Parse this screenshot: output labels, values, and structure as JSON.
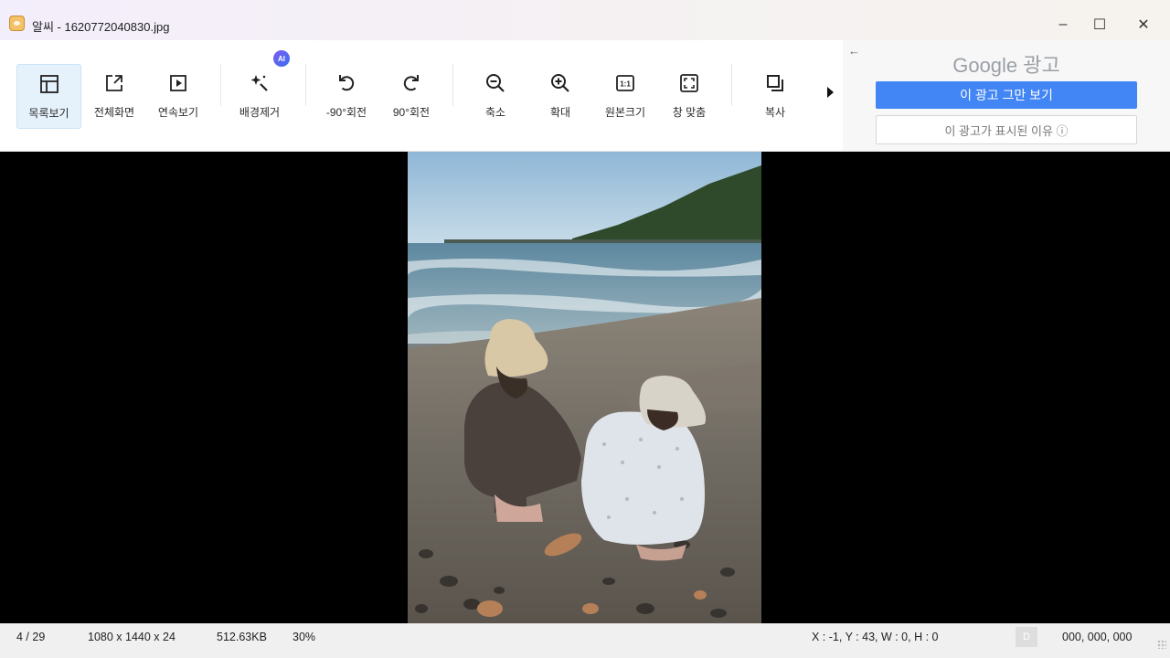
{
  "window": {
    "title": "알씨 - 1620772040830.jpg",
    "controls": {
      "minimize": "–",
      "maximize": "☐",
      "close": "✕"
    }
  },
  "toolbar": {
    "tools": [
      {
        "id": "list-view",
        "label": "목록보기",
        "icon": "layout-icon"
      },
      {
        "id": "fullscreen",
        "label": "전체화면",
        "icon": "external-window-icon"
      },
      {
        "id": "slideshow",
        "label": "연속보기",
        "icon": "play-icon"
      },
      {
        "id": "remove-bg",
        "label": "배경제거",
        "icon": "magic-wand-icon"
      },
      {
        "id": "rotate-left",
        "label": "-90°회전",
        "icon": "rotate-ccw-icon"
      },
      {
        "id": "rotate-right",
        "label": "90°회전",
        "icon": "rotate-cw-icon"
      },
      {
        "id": "zoom-out",
        "label": "축소",
        "icon": "zoom-out-icon"
      },
      {
        "id": "zoom-in",
        "label": "확대",
        "icon": "zoom-in-icon"
      },
      {
        "id": "original-size",
        "label": "원본크기",
        "icon": "one-to-one-icon"
      },
      {
        "id": "fit-window",
        "label": "창 맞춤",
        "icon": "fit-frame-icon"
      },
      {
        "id": "copy",
        "label": "복사",
        "icon": "copy-icon"
      }
    ],
    "ai_badge": "AI"
  },
  "ad": {
    "back": "←",
    "brand": "Google 광고",
    "stop_button": "이 광고 그만 보기",
    "why_button": "이 광고가 표시된 이유 ⓘ"
  },
  "status": {
    "index": "4 / 29",
    "dimensions": "1080 x 1440 x 24",
    "filesize": "512.63KB",
    "zoom": "30%",
    "coords": "X : -1, Y : 43, W : 0, H : 0",
    "d_label": "D",
    "rgb": "000, 000, 000"
  },
  "colors": {
    "accent_blue": "#4285f4",
    "active_tool_bg": "#e5f1fb",
    "viewer_bg": "#000000"
  }
}
